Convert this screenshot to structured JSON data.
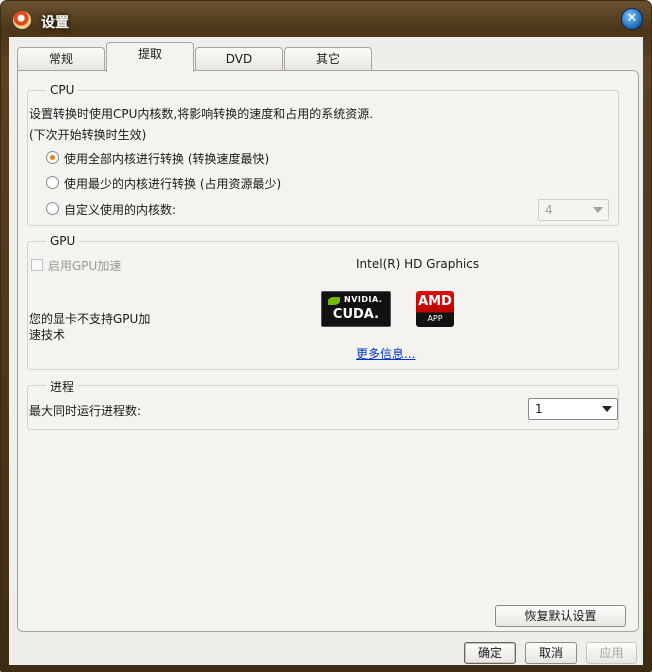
{
  "window": {
    "title": "设置"
  },
  "tabs": [
    "常规",
    "提取",
    "DVD",
    "其它"
  ],
  "cpu": {
    "title": "CPU",
    "desc": "设置转换时使用CPU内核数,将影响转换的速度和占用的系统资源.",
    "note": "(下次开始转换时生效)",
    "options": [
      "使用全部内核进行转换 (转换速度最快)",
      "使用最少的内核进行转换 (占用资源最少)",
      "自定义使用的内核数:"
    ],
    "selected_index": 0,
    "core_count": "4"
  },
  "gpu": {
    "title": "GPU",
    "enable_label": "启用GPU加速",
    "graphics_name": "Intel(R) HD Graphics",
    "unsupported_line1": "您的显卡不支持GPU加",
    "unsupported_line2": "速技术",
    "nvidia_logo": {
      "brand": "NVIDIA.",
      "product": "CUDA."
    },
    "amd_logo": {
      "brand": "AMD",
      "product": "APP"
    },
    "more_info": "更多信息..."
  },
  "process": {
    "title": "进程",
    "label": "最大同时运行进程数:",
    "value": "1"
  },
  "buttons": {
    "restore_defaults": "恢复默认设置",
    "ok": "确定",
    "cancel": "取消",
    "apply": "应用"
  },
  "colors": {
    "radio_checked": "#e67e22",
    "link": "#0033cc",
    "nvidia_green": "#76b900",
    "amd_red": "#cc1111"
  }
}
